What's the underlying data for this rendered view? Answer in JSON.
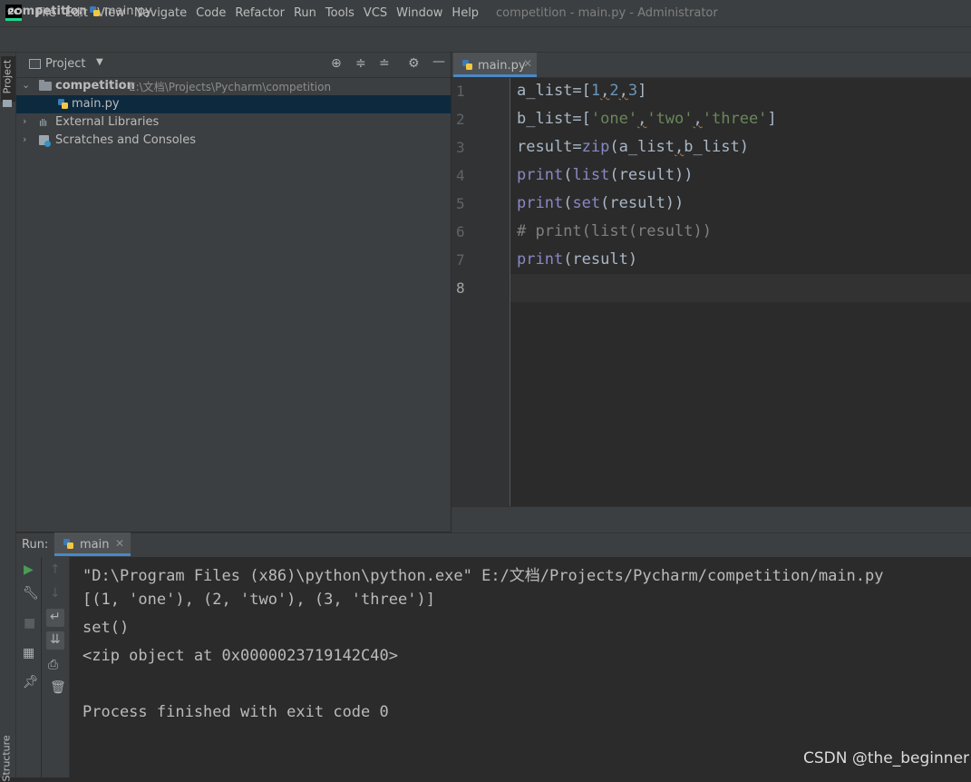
{
  "app": {
    "logo": "PC",
    "window_title": "competition - main.py - Administrator"
  },
  "menu": [
    "File",
    "Edit",
    "View",
    "Navigate",
    "Code",
    "Refactor",
    "Run",
    "Tools",
    "VCS",
    "Window",
    "Help"
  ],
  "breadcrumb": {
    "project": "competition",
    "separator": "〉",
    "file": "main.py"
  },
  "left_strip": {
    "project_label": "Project",
    "structure_label": "Structure"
  },
  "project_panel": {
    "title": "Project",
    "tree": [
      {
        "label": "competition",
        "path": "E:\\文档\\Projects\\Pycharm\\competition",
        "expanded": true
      },
      {
        "label": "main.py",
        "selected": true
      },
      {
        "label": "External Libraries",
        "expanded": false
      },
      {
        "label": "Scratches and Consoles",
        "expanded": false
      }
    ],
    "icons": [
      "locate-icon",
      "expand-all-icon",
      "collapse-all-icon",
      "settings-icon",
      "hide-icon"
    ]
  },
  "editor": {
    "tab_label": "main.py",
    "line_numbers": [
      "1",
      "2",
      "3",
      "4",
      "5",
      "6",
      "7",
      "8"
    ],
    "active_line": "8",
    "code_lines": [
      "a_list=[1,2,3]",
      "b_list=['one','two','three']",
      "result=zip(a_list,b_list)",
      "print(list(result))",
      "print(set(result))",
      "# print(list(result))",
      "print(result)",
      ""
    ]
  },
  "run_panel": {
    "label": "Run:",
    "tab_label": "main",
    "console_lines": [
      "\"D:\\Program Files (x86)\\python\\python.exe\" E:/文档/Projects/Pycharm/competition/main.py",
      "[(1, 'one'), (2, 'two'), (3, 'three')]",
      "set()",
      "<zip object at 0x0000023719142C40>",
      "",
      "Process finished with exit code 0"
    ]
  },
  "watermark": "CSDN @the_beginner",
  "colors": {
    "background": "#2b2b2b",
    "panel": "#3c3f41",
    "selection": "#0d293e",
    "keyword_builtin": "#8888c6",
    "number": "#6897bb",
    "string": "#6a8759",
    "comment": "#808080",
    "run_green": "#499c54"
  }
}
